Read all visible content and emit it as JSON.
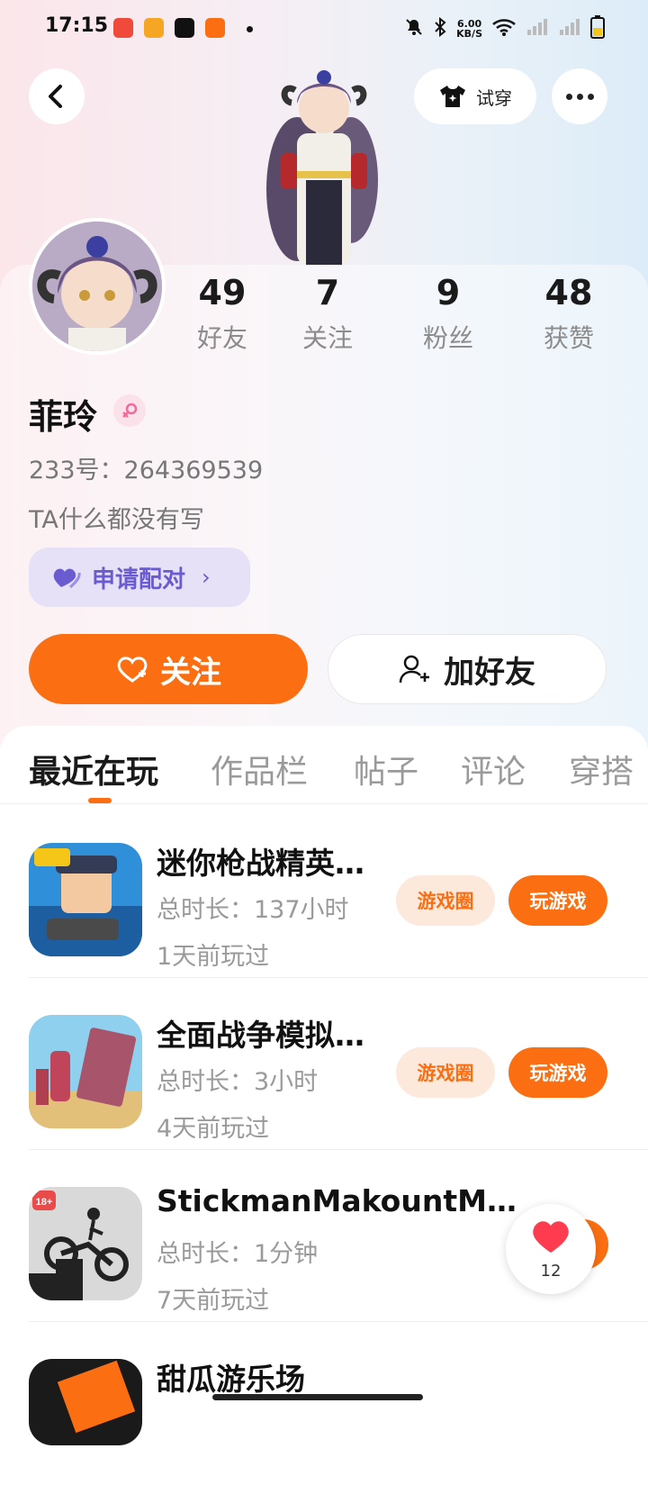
{
  "status_bar": {
    "time": "17:15",
    "net_speed_value": "6.00",
    "net_speed_unit": "KB/S",
    "icons": [
      "notifications-muted-icon",
      "bluetooth-icon",
      "wifi-icon",
      "signal-icon",
      "signal-icon",
      "battery-icon"
    ]
  },
  "header": {
    "tryon_label": "试穿",
    "icons": [
      "back-icon",
      "tshirt-icon",
      "more-icon"
    ]
  },
  "profile": {
    "stats": [
      {
        "value": "49",
        "label": "好友"
      },
      {
        "value": "7",
        "label": "关注"
      },
      {
        "value": "9",
        "label": "粉丝"
      },
      {
        "value": "48",
        "label": "获赞"
      }
    ],
    "name": "菲玲",
    "gender_icon": "female-icon",
    "uid_text": "233号：264369539",
    "bio": "TA什么都没有写",
    "pair_label": "申请配对",
    "pair_chevron": "›"
  },
  "actions": {
    "follow_label": "关注",
    "add_friend_label": "加好友"
  },
  "tabs": [
    "最近在玩",
    "作品栏",
    "帖子",
    "评论",
    "穿搭"
  ],
  "games": [
    {
      "title": "迷你枪战精英…",
      "duration": "总时长：137小时",
      "last_played": "1天前玩过",
      "circle_label": "游戏圈",
      "play_label": "玩游戏"
    },
    {
      "title": "全面战争模拟…",
      "duration": "总时长：3小时",
      "last_played": "4天前玩过",
      "circle_label": "游戏圈",
      "play_label": "玩游戏"
    },
    {
      "title": "StickmanMakountM…",
      "duration": "总时长：1分钟",
      "last_played": "7天前玩过"
    },
    {
      "title": "甜瓜游乐场"
    }
  ],
  "game4_icon_badge": "18+",
  "floating_like": {
    "count": "12"
  },
  "colors": {
    "accent": "#fb6f12",
    "pair_purple": "#6a5bd1",
    "muted_text": "#9a9a9a"
  }
}
